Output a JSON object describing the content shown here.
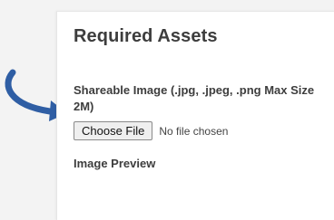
{
  "section": {
    "title": "Required Assets"
  },
  "upload": {
    "label": "Shareable Image (.jpg, .jpeg, .png Max Size 2M)",
    "button_label": "Choose File",
    "status_text": "No file chosen"
  },
  "preview": {
    "label": "Image Preview"
  },
  "annotation": {
    "icon": "curved-arrow-icon",
    "color": "#2f5ea4"
  }
}
